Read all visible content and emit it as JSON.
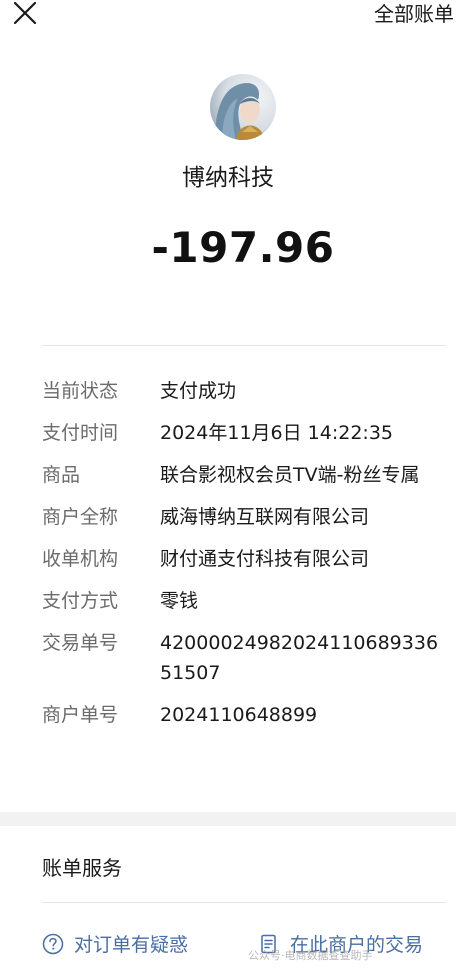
{
  "header": {
    "close_icon": "close-icon",
    "all_bills_label": "全部账单"
  },
  "merchant": {
    "name": "博纳科技",
    "amount": "-197.96"
  },
  "details": [
    {
      "label": "当前状态",
      "value": "支付成功"
    },
    {
      "label": "支付时间",
      "value": "2024年11月6日 14:22:35"
    },
    {
      "label": "商品",
      "value": "联合影视权会员TV端-粉丝专属"
    },
    {
      "label": "商户全称",
      "value": "威海博纳互联网有限公司"
    },
    {
      "label": "收单机构",
      "value": "财付通支付科技有限公司"
    },
    {
      "label": "支付方式",
      "value": "零钱"
    },
    {
      "label": "交易单号",
      "value": "4200002498202411068933651507"
    },
    {
      "label": "商户单号",
      "value": "2024110648899"
    }
  ],
  "services": {
    "title": "账单服务",
    "question_label": "对订单有疑惑",
    "question_icon": "question-circle-icon",
    "merchant_tx_label": "在此商户的交易",
    "merchant_tx_icon": "receipt-icon"
  },
  "watermark": "公众号·电商数据查查助手"
}
